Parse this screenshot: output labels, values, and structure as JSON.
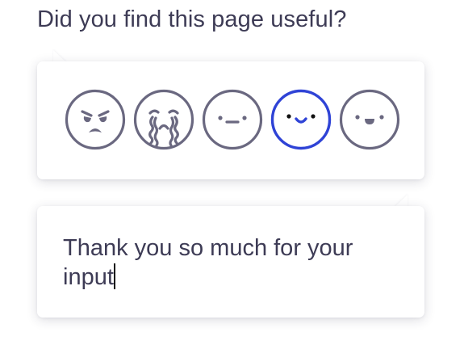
{
  "question": "Did you find this page useful?",
  "rating": {
    "selected_index": 3,
    "colors": {
      "default": "#6a6880",
      "selected": "#2f43d6"
    },
    "options": [
      {
        "icon": "angry-face-icon"
      },
      {
        "icon": "crying-face-icon"
      },
      {
        "icon": "neutral-face-icon"
      },
      {
        "icon": "smiling-face-icon"
      },
      {
        "icon": "happy-face-icon"
      }
    ]
  },
  "feedback": {
    "text": "Thank you so much for your input"
  }
}
